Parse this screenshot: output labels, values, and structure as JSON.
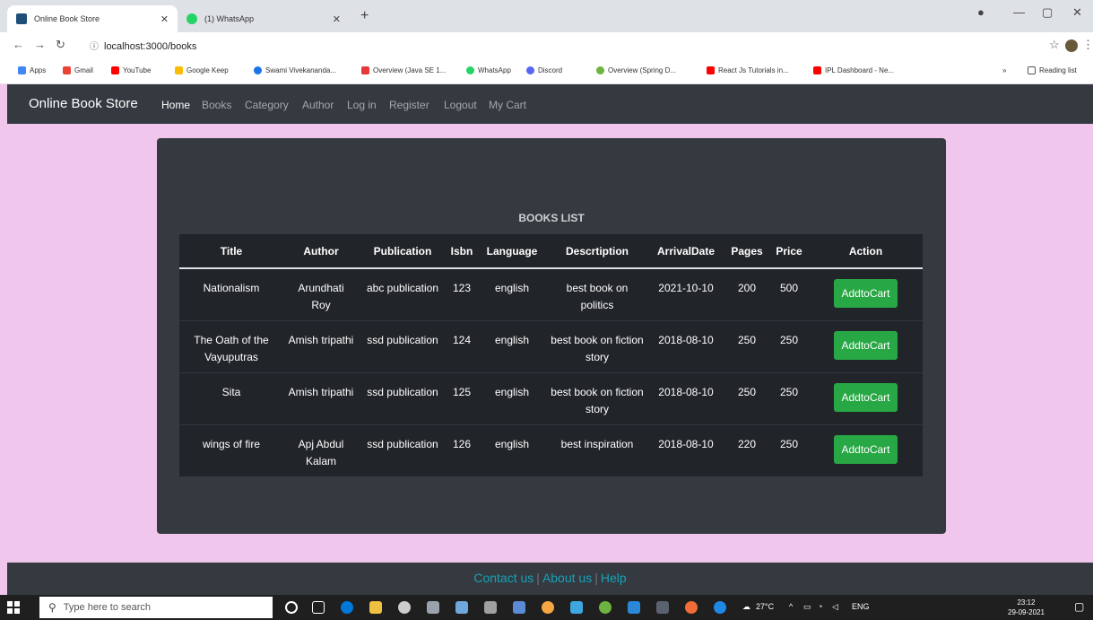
{
  "browser": {
    "tabs": [
      {
        "title": "Online Book Store",
        "fav_color": "#1f4e79"
      },
      {
        "title": "(1) WhatsApp",
        "fav_color": "#25d366"
      }
    ],
    "url": "localhost:3000/books",
    "bookmarks": [
      {
        "label": "Apps",
        "color": "#4285f4"
      },
      {
        "label": "Gmail",
        "color": "#ea4335"
      },
      {
        "label": "YouTube",
        "color": "#ff0000"
      },
      {
        "label": "Google Keep",
        "color": "#fbbc04"
      },
      {
        "label": "Swami Vivekananda...",
        "color": "#1a73e8"
      },
      {
        "label": "Overview (Java SE 1...",
        "color": "#e53935"
      },
      {
        "label": "WhatsApp",
        "color": "#25d366"
      },
      {
        "label": "Discord",
        "color": "#5865f2"
      },
      {
        "label": "Overview (Spring D...",
        "color": "#6db33f"
      },
      {
        "label": "React Js Tutorials in...",
        "color": "#ff0000"
      },
      {
        "label": "IPL Dashboard - Ne...",
        "color": "#ff0000"
      }
    ],
    "reading_list": "Reading list"
  },
  "navbar": {
    "brand": "Online Book Store",
    "links": [
      "Home",
      "Books",
      "Category",
      "Author",
      "Log in",
      "Register",
      "Logout",
      "My Cart"
    ]
  },
  "books": {
    "title": "BOOKS LIST",
    "headers": [
      "Title",
      "Author",
      "Publication",
      "Isbn",
      "Language",
      "Descrtiption",
      "ArrivalDate",
      "Pages",
      "Price",
      "Action"
    ],
    "rows": [
      {
        "title": "Nationalism",
        "author": "Arundhati Roy",
        "publication": "abc publication",
        "isbn": "123",
        "language": "english",
        "description": "best book on politics",
        "arrival": "2021-10-10",
        "pages": "200",
        "price": "500",
        "action": "AddtoCart"
      },
      {
        "title": "The Oath of the Vayuputras",
        "author": "Amish tripathi",
        "publication": "ssd publication",
        "isbn": "124",
        "language": "english",
        "description": "best book on fiction story",
        "arrival": "2018-08-10",
        "pages": "250",
        "price": "250",
        "action": "AddtoCart"
      },
      {
        "title": "Sita",
        "author": "Amish tripathi",
        "publication": "ssd publication",
        "isbn": "125",
        "language": "english",
        "description": "best book on fiction story",
        "arrival": "2018-08-10",
        "pages": "250",
        "price": "250",
        "action": "AddtoCart"
      },
      {
        "title": "wings of fire",
        "author": "Apj Abdul Kalam",
        "publication": "ssd publication",
        "isbn": "126",
        "language": "english",
        "description": "best inspiration",
        "arrival": "2018-08-10",
        "pages": "220",
        "price": "250",
        "action": "AddtoCart"
      }
    ]
  },
  "footer": {
    "links": [
      "Contact us",
      "About us",
      "Help"
    ],
    "separator": "|"
  },
  "taskbar": {
    "search_placeholder": "Type here to search",
    "weather": "27°C",
    "lang": "ENG",
    "time": "23:12",
    "date": "29-09-2021"
  },
  "colors": {
    "page_bg": "#f1c6ec",
    "dark": "#343a40",
    "table": "#212529",
    "button": "#28a745",
    "footer_link": "#17a2b8"
  }
}
